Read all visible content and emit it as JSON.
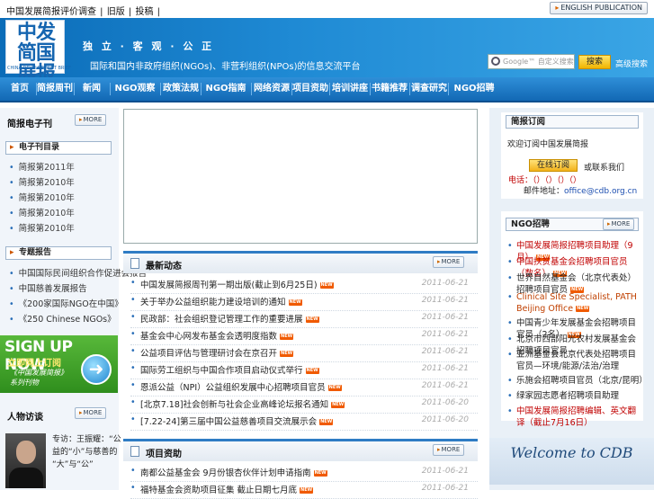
{
  "top": {
    "links": [
      "中国发展简报评价调查",
      "旧版",
      "投稿"
    ],
    "english_button": "ENGLISH PUBLICATION"
  },
  "banner": {
    "logo_cn": "中发简国展报",
    "logo_en": "CHINA DEVELOPMENT BRIEF",
    "slogan": "独 立 · 客 观 · 公 正",
    "tagline": "国际和国内非政府组织(NGOs)、非营利组织(NPOs)的信息交流平台",
    "search_placeholder": "Google™ 自定义搜索",
    "search_button": "搜索",
    "advanced": "高级搜索"
  },
  "nav": [
    "首页",
    "简报周刊",
    "新闻",
    "NGO观察",
    "政策法规",
    "NGO指南",
    "网络资源",
    "项目资助",
    "培训讲座",
    "书籍推荐",
    "调查研究",
    "NGO招聘"
  ],
  "left": {
    "periodical_title": "简报电子刊",
    "more": "MORE",
    "issues_box": "电子刊目录",
    "issues": [
      {
        "label": "简报第",
        "year": "2011年"
      },
      {
        "label": "简报第",
        "year": "2010年"
      },
      {
        "label": "简报第",
        "year": "2010年"
      },
      {
        "label": "简报第",
        "year": "2010年"
      },
      {
        "label": "简报第",
        "year": "2010年"
      }
    ],
    "special_box": "专题报告",
    "special_items": [
      "中国国际民间组织合作促进会报告",
      "中国慈善发展报告",
      "《200家国际NGO在中国》",
      "《250 Chinese NGOs》"
    ],
    "signup": {
      "big": "SIGN UP NOW",
      "sub": "立即网上订阅",
      "line1": "《中国发展简报》",
      "line2": "系列刊物"
    },
    "interview_title": "人物访谈",
    "interview_text": [
      "专访：王振耀：“公",
      "益的“小”与慈善的",
      "“大”与“公”"
    ]
  },
  "center": {
    "section1": {
      "title": "最新动态",
      "more": "MORE",
      "items": [
        {
          "text": "中国发展简报周刊第一期出版(截止到6月25日)",
          "date": "2011-06-21"
        },
        {
          "text": "关于举办公益组织能力建设培训的通知",
          "date": "2011-06-21"
        },
        {
          "text": "民政部：社会组织登记管理工作的重要进展",
          "date": "2011-06-21"
        },
        {
          "text": "基金会中心网发布基金会透明度指数",
          "date": "2011-06-21"
        },
        {
          "text": "公益项目评估与管理研讨会在京召开",
          "date": "2011-06-21"
        },
        {
          "text": "国际劳工组织与中国合作项目启动仪式举行",
          "date": "2011-06-21"
        },
        {
          "text": "恩派公益（NPI）公益组织发展中心招聘项目官员",
          "date": "2011-06-21"
        },
        {
          "text": "[北京7.18]社会创新与社会企业高峰论坛报名通知",
          "date": "2011-06-20"
        },
        {
          "text": "[7.22-24]第三届中国公益慈善项目交流展示会",
          "date": "2011-06-20"
        }
      ]
    },
    "section2": {
      "title": "项目资助",
      "more": "MORE",
      "items": [
        {
          "text": "南都公益基金会 9月份银杏伙伴计划申请指南",
          "date": "2011-06-21"
        },
        {
          "text": "福特基金会资助项目征集  截止日期七月底",
          "date": "2011-06-21"
        }
      ]
    }
  },
  "right": {
    "subscribe": {
      "title": "简报订阅",
      "line1": "欢迎订阅中国发展简报",
      "button": "在线订阅",
      "after_button": "或联系我们",
      "red_line": "电话：（）（）（）（）",
      "email_label": "邮件地址：",
      "email": "office@cdb.org.cn"
    },
    "jobs": {
      "title": "NGO招聘",
      "more": "MORE",
      "items": [
        {
          "text": "中国发展简报招聘项目助理（9月）",
          "red": true,
          "new": true
        },
        {
          "text": "中国扶贫基金会招聘项目官员（数名）",
          "red": true,
          "new": true
        },
        {
          "text": "世界自然基金会（北京代表处）招聘项目官员",
          "red": false,
          "new": true
        },
        {
          "text": "Clinical Site Specialist, PATH Beijing Office",
          "red": false,
          "new": true,
          "en": true
        },
        {
          "text": "中国青少年发展基金会招聘项目官员（2名）",
          "red": false,
          "new": true
        },
        {
          "text": "北京市西部阳光农村发展基金会招聘项目官员",
          "red": false,
          "new": false
        },
        {
          "text": "亚洲基金会北京代表处招聘项目官员—环境/能源/法治/治理",
          "red": false,
          "new": false
        },
        {
          "text": "乐施会招聘项目官员（北京/昆明）",
          "red": false,
          "new": false
        },
        {
          "text": "绿家园志愿者招聘项目助理",
          "red": false,
          "new": false
        },
        {
          "text": "中国发展简报招聘编辑、英文翻译（截止7月16日）",
          "red": true,
          "new": false
        }
      ]
    },
    "welcome": "Welcome to CDB"
  }
}
